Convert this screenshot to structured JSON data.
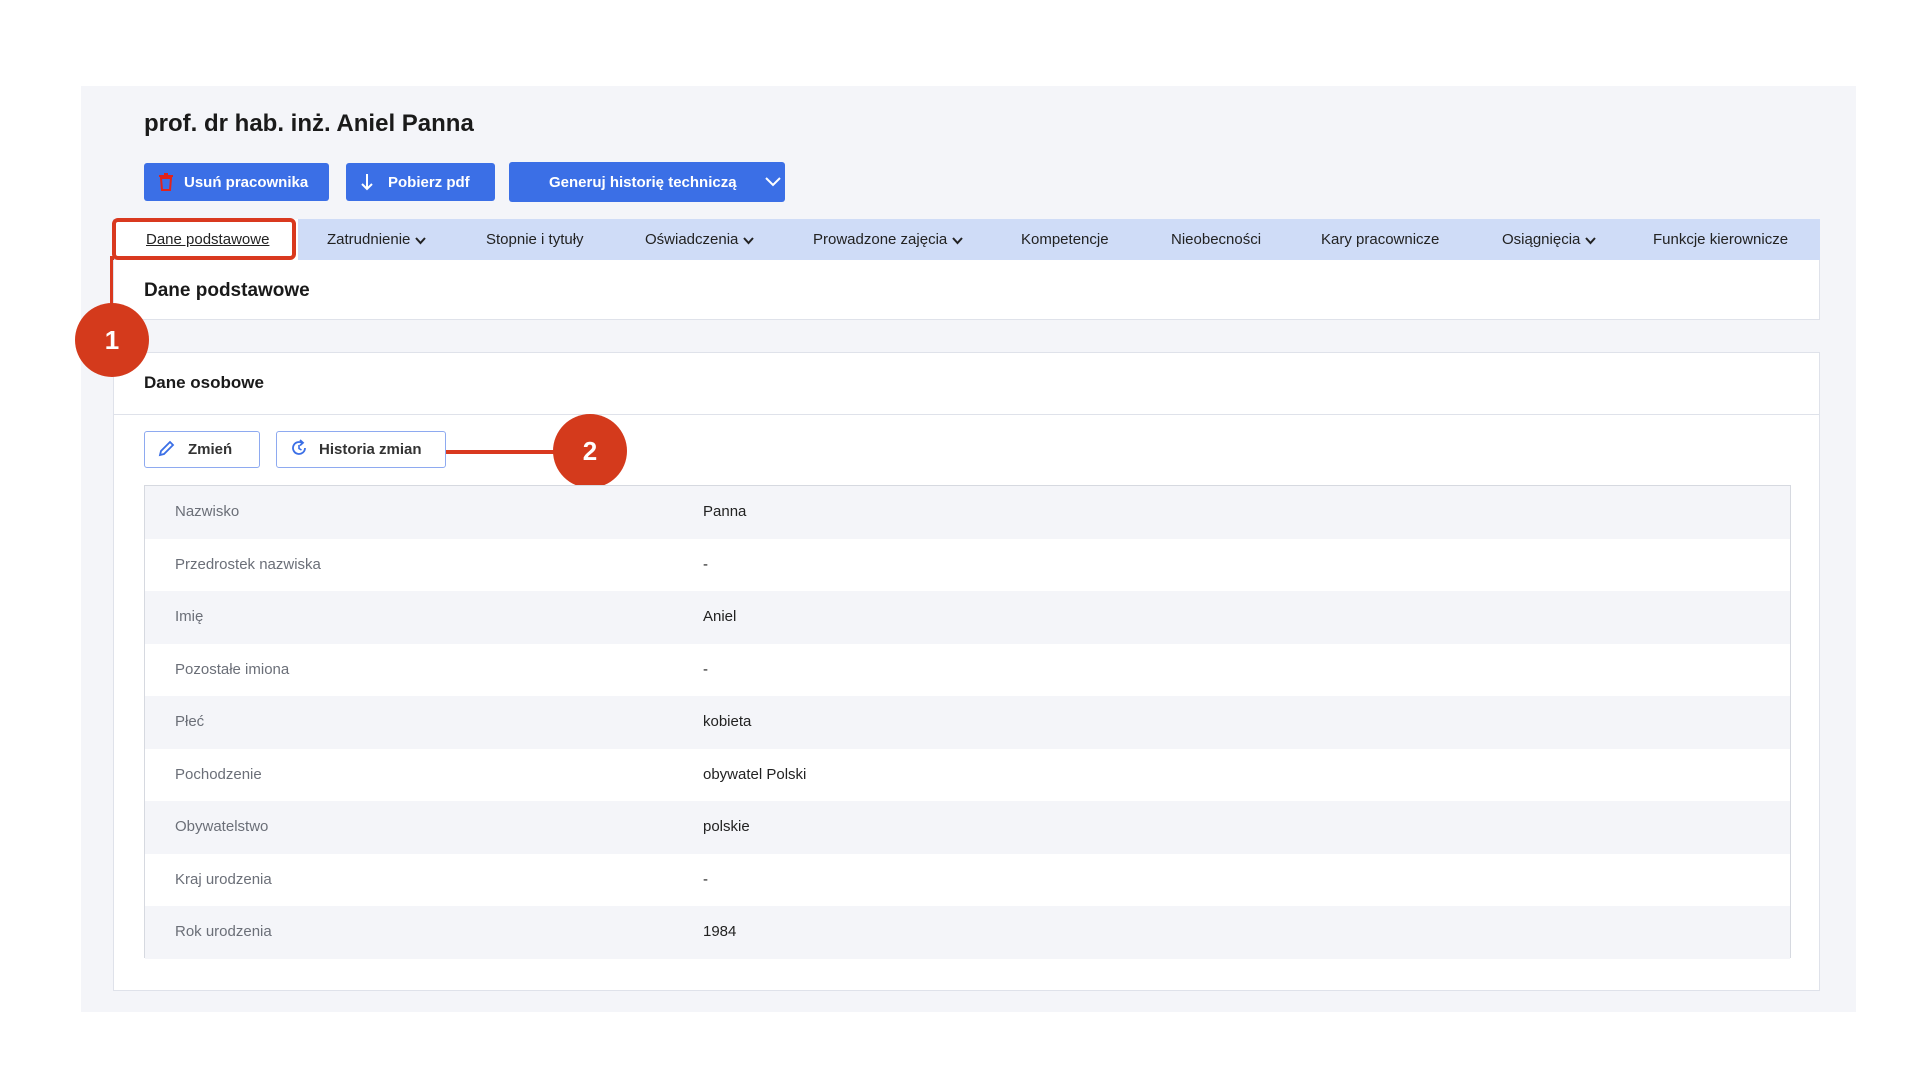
{
  "page": {
    "title": "prof. dr hab. inż. Aniel Panna"
  },
  "actions": {
    "delete_label": "Usuń pracownika",
    "pdf_label": "Pobierz pdf",
    "generate_label": "Generuj historię techniczą"
  },
  "tabs": [
    {
      "label": "Dane podstawowe",
      "dropdown": false
    },
    {
      "label": "Zatrudnienie",
      "dropdown": true
    },
    {
      "label": "Stopnie i tytuły",
      "dropdown": false
    },
    {
      "label": "Oświadczenia",
      "dropdown": true
    },
    {
      "label": "Prowadzone zajęcia",
      "dropdown": true
    },
    {
      "label": "Kompetencje",
      "dropdown": false
    },
    {
      "label": "Nieobecności",
      "dropdown": false
    },
    {
      "label": "Kary pracownicze",
      "dropdown": false
    },
    {
      "label": "Osiągnięcia",
      "dropdown": true
    },
    {
      "label": "Funkcje kierownicze",
      "dropdown": false
    }
  ],
  "section": {
    "title": "Dane podstawowe"
  },
  "personal": {
    "title": "Dane osobowe",
    "edit_label": "Zmień",
    "history_label": "Historia zmian",
    "rows": [
      {
        "label": "Nazwisko",
        "value": "Panna"
      },
      {
        "label": "Przedrostek nazwiska",
        "value": "-"
      },
      {
        "label": "Imię",
        "value": "Aniel"
      },
      {
        "label": "Pozostałe imiona",
        "value": "-"
      },
      {
        "label": "Płeć",
        "value": "kobieta"
      },
      {
        "label": "Pochodzenie",
        "value": "obywatel Polski"
      },
      {
        "label": "Obywatelstwo",
        "value": "polskie"
      },
      {
        "label": "Kraj urodzenia",
        "value": "-"
      },
      {
        "label": "Rok urodzenia",
        "value": "1984"
      }
    ]
  },
  "annotations": {
    "badge1": "1",
    "badge2": "2"
  },
  "colors": {
    "primary": "#3b6fe6",
    "tab_bar": "#cfdcf7",
    "annotation": "#d43a1c",
    "panel_bg": "#f4f5f9"
  },
  "icons": {
    "delete": "trash-icon",
    "pdf": "download-arrow-icon",
    "generate": "chevron-down-icon",
    "edit": "pencil-icon",
    "history": "refresh-icon"
  }
}
